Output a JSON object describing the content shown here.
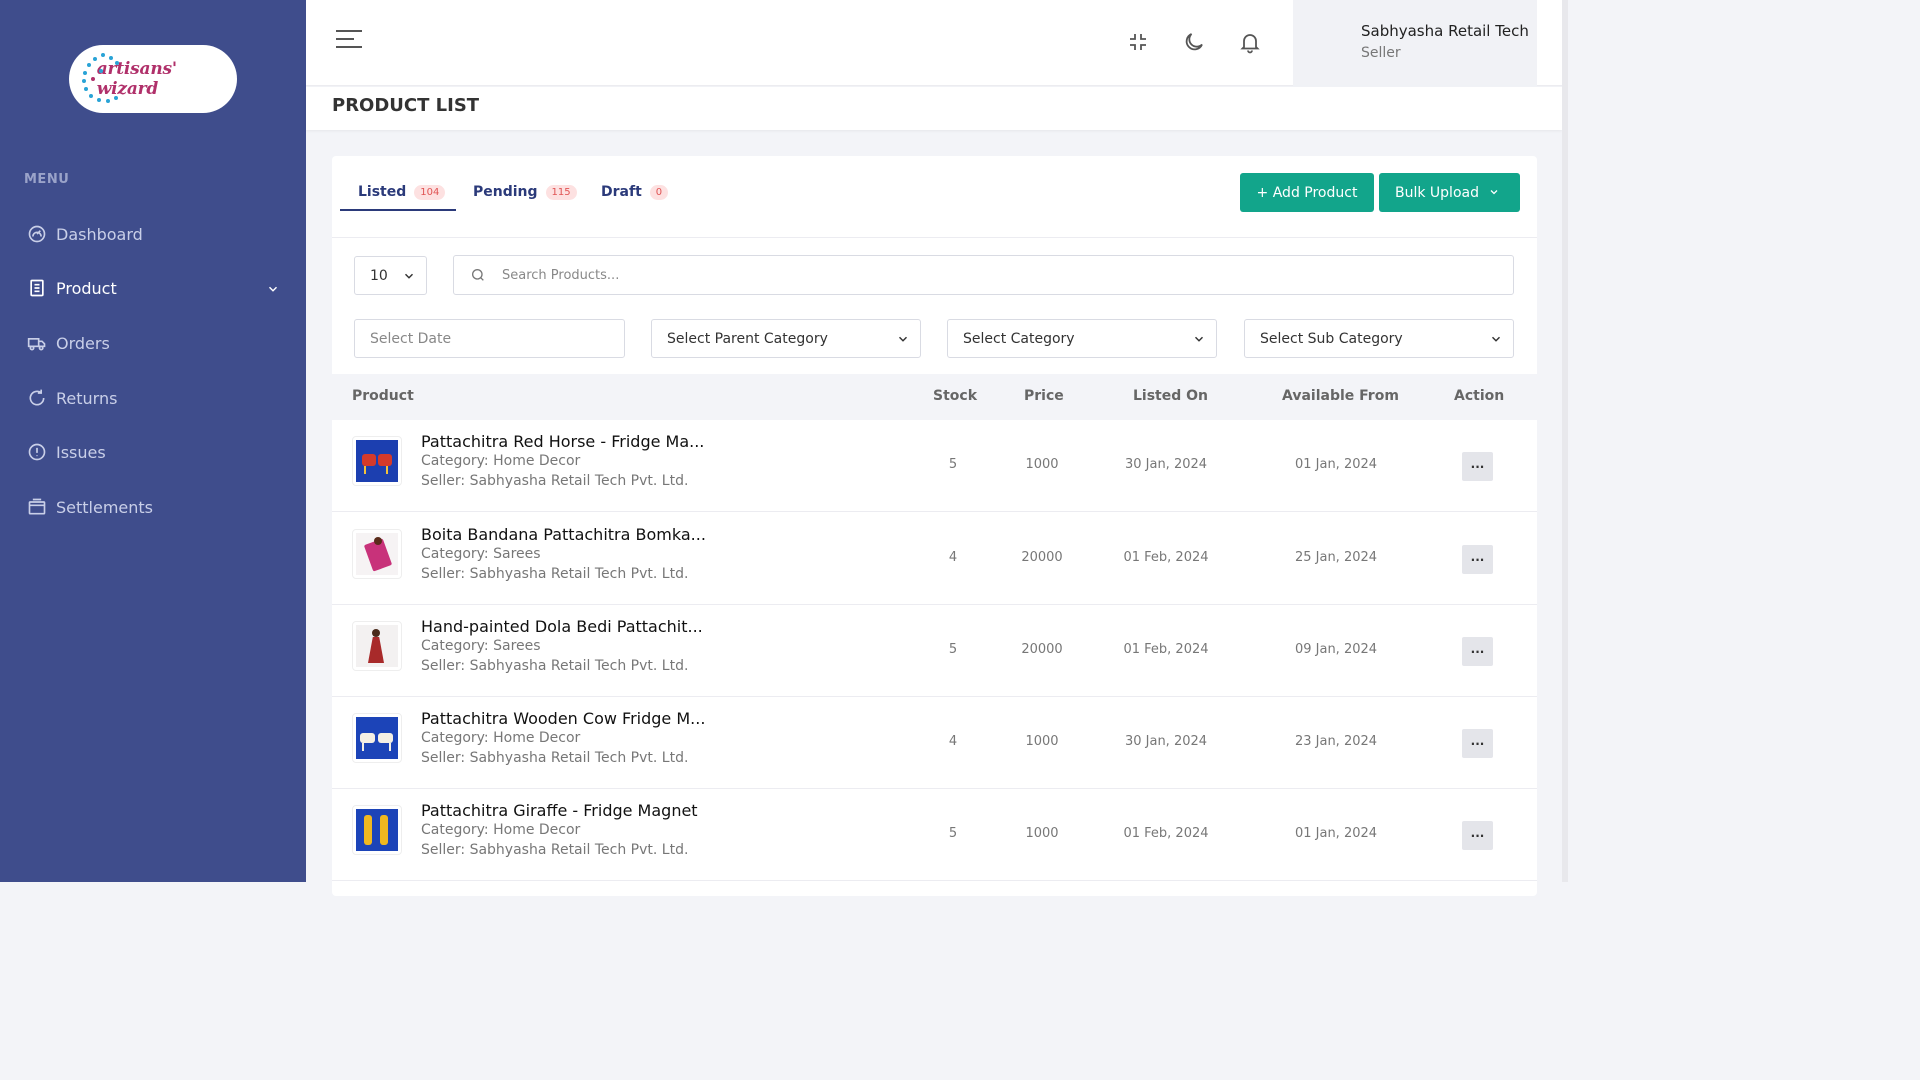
{
  "sidebar": {
    "logo_text": "artisans' wizard",
    "menu_title": "MENU",
    "items": [
      {
        "label": "Dashboard",
        "icon": "dashboard-icon"
      },
      {
        "label": "Product",
        "icon": "document-icon"
      },
      {
        "label": "Orders",
        "icon": "truck-icon"
      },
      {
        "label": "Returns",
        "icon": "refresh-icon"
      },
      {
        "label": "Issues",
        "icon": "alert-circle-icon"
      },
      {
        "label": "Settlements",
        "icon": "wallet-icon"
      }
    ]
  },
  "header": {
    "user_name": "Sabhyasha Retail Tech",
    "user_role": "Seller"
  },
  "page": {
    "title": "PRODUCT LIST"
  },
  "tabs": [
    {
      "label": "Listed",
      "count": "104"
    },
    {
      "label": "Pending",
      "count": "115"
    },
    {
      "label": "Draft",
      "count": "0"
    }
  ],
  "actions": {
    "add_product": "+  Add Product",
    "bulk_upload": "Bulk Upload"
  },
  "filters": {
    "page_size": "10",
    "search_placeholder": "Search Products...",
    "date_placeholder": "Select Date",
    "parent_category": "Select Parent Category",
    "category": "Select Category",
    "sub_category": "Select Sub Category"
  },
  "table": {
    "headers": {
      "product": "Product",
      "stock": "Stock",
      "price": "Price",
      "listed_on": "Listed On",
      "available_from": "Available From",
      "action": "Action"
    },
    "action_label": "···",
    "rows": [
      {
        "name": "Pattachitra Red Horse - Fridge Ma...",
        "category": "Category: Home Decor",
        "seller": "Seller: Sabhyasha Retail Tech Pvt. Ltd.",
        "stock": "5",
        "price": "1000",
        "listed_on": "30 Jan, 2024",
        "available_from": "01 Jan, 2024"
      },
      {
        "name": "Boita Bandana Pattachitra Bomka...",
        "category": "Category: Sarees",
        "seller": "Seller: Sabhyasha Retail Tech Pvt. Ltd.",
        "stock": "4",
        "price": "20000",
        "listed_on": "01 Feb, 2024",
        "available_from": "25 Jan, 2024"
      },
      {
        "name": "Hand-painted Dola Bedi Pattachit...",
        "category": "Category: Sarees",
        "seller": "Seller: Sabhyasha Retail Tech Pvt. Ltd.",
        "stock": "5",
        "price": "20000",
        "listed_on": "01 Feb, 2024",
        "available_from": "09 Jan, 2024"
      },
      {
        "name": "Pattachitra Wooden Cow Fridge M...",
        "category": "Category: Home Decor",
        "seller": "Seller: Sabhyasha Retail Tech Pvt. Ltd.",
        "stock": "4",
        "price": "1000",
        "listed_on": "30 Jan, 2024",
        "available_from": "23 Jan, 2024"
      },
      {
        "name": "Pattachitra Giraffe - Fridge Magnet",
        "category": "Category: Home Decor",
        "seller": "Seller: Sabhyasha Retail Tech Pvt. Ltd.",
        "stock": "5",
        "price": "1000",
        "listed_on": "01 Feb, 2024",
        "available_from": "01 Jan, 2024"
      }
    ]
  },
  "colors": {
    "sidebar": "#3f4d8c",
    "accent": "#12a58b",
    "badge_bg": "#fde1e1",
    "badge_text": "#e05454"
  }
}
